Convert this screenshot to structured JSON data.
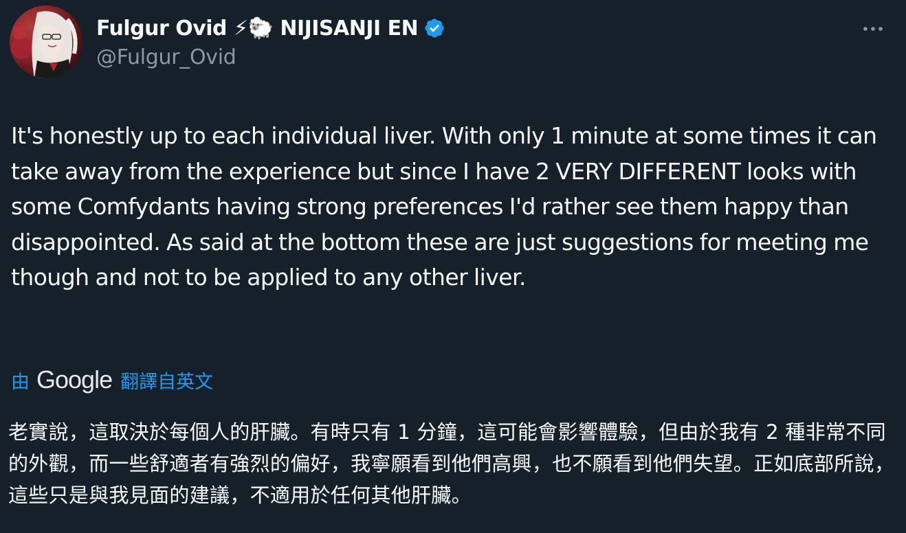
{
  "author": {
    "display_name": "Fulgur Ovid ⚡🐑 NIJISANJI EN",
    "handle": "@Fulgur_Ovid",
    "verified": true
  },
  "tweet": {
    "text": "It's honestly up to each individual liver. With only 1 minute at some times it can take away from the experience but since I have 2 VERY DIFFERENT looks with some Comfydants having strong preferences I'd rather see them happy than disappointed. As said at the bottom these are just suggestions for meeting me though and not to be applied to any other liver.",
    "translate_prefix": "由",
    "translate_brand": "Google",
    "translate_suffix": "翻譯自英文",
    "translated_text": "老實說，這取決於每個人的肝臟。有時只有 1 分鐘，這可能會影響體驗，但由於我有 2 種非常不同的外觀，而一些舒適者有強烈的偏好，我寧願看到他們高興，也不願看到他們失望。正如底部所說，這些只是與我見面的建議，不適用於任何其他肝臟。"
  },
  "colors": {
    "background": "#15202b",
    "text": "#f7f9f9",
    "secondary": "#8b98a5",
    "accent": "#1d9bf0"
  },
  "icons": {
    "verified": "verified-badge-icon",
    "more": "more-horizontal-icon"
  }
}
